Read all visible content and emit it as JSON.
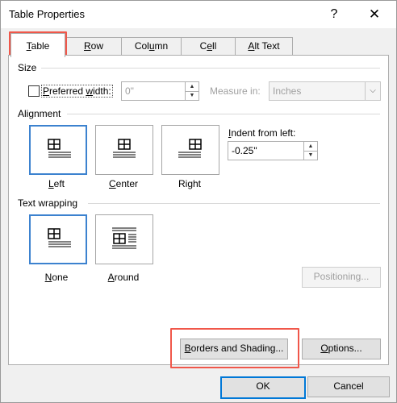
{
  "window": {
    "title": "Table Properties",
    "help": "?",
    "close": "✕"
  },
  "tabs": [
    {
      "label_pre": "",
      "label_u": "T",
      "label_post": "able"
    },
    {
      "label_pre": "",
      "label_u": "R",
      "label_post": "ow"
    },
    {
      "label_pre": "Col",
      "label_u": "u",
      "label_post": "mn"
    },
    {
      "label_pre": "C",
      "label_u": "e",
      "label_post": "ll"
    },
    {
      "label_pre": "",
      "label_u": "A",
      "label_post": "lt Text"
    }
  ],
  "size": {
    "group": "Size",
    "preferred_pre": "",
    "preferred_u": "P",
    "preferred_mid": "referred ",
    "preferred_u2": "w",
    "preferred_post": "idth:",
    "width_value": "0\"",
    "measure_label": "Measure in:",
    "measure_value": "Inches"
  },
  "alignment": {
    "group": "Alignment",
    "options": [
      {
        "pre": "",
        "u": "L",
        "post": "eft"
      },
      {
        "pre": "",
        "u": "C",
        "post": "enter"
      },
      {
        "pre": "Ri",
        "u": "g",
        "post": "ht"
      }
    ],
    "indent_label_pre": "",
    "indent_label_u": "I",
    "indent_label_post": "ndent from left:",
    "indent_value": "-0.25\""
  },
  "wrapping": {
    "group": "Text wrapping",
    "options": [
      {
        "pre": "",
        "u": "N",
        "post": "one"
      },
      {
        "pre": "",
        "u": "A",
        "post": "round"
      }
    ],
    "positioning": "Positioning..."
  },
  "buttons": {
    "borders_pre": "",
    "borders_u": "B",
    "borders_post": "orders and Shading...",
    "options_pre": "",
    "options_u": "O",
    "options_post": "ptions...",
    "ok": "OK",
    "cancel": "Cancel"
  },
  "colors": {
    "highlight": "#f0574a",
    "selected": "#3c82cf",
    "default_button": "#0078d7"
  }
}
